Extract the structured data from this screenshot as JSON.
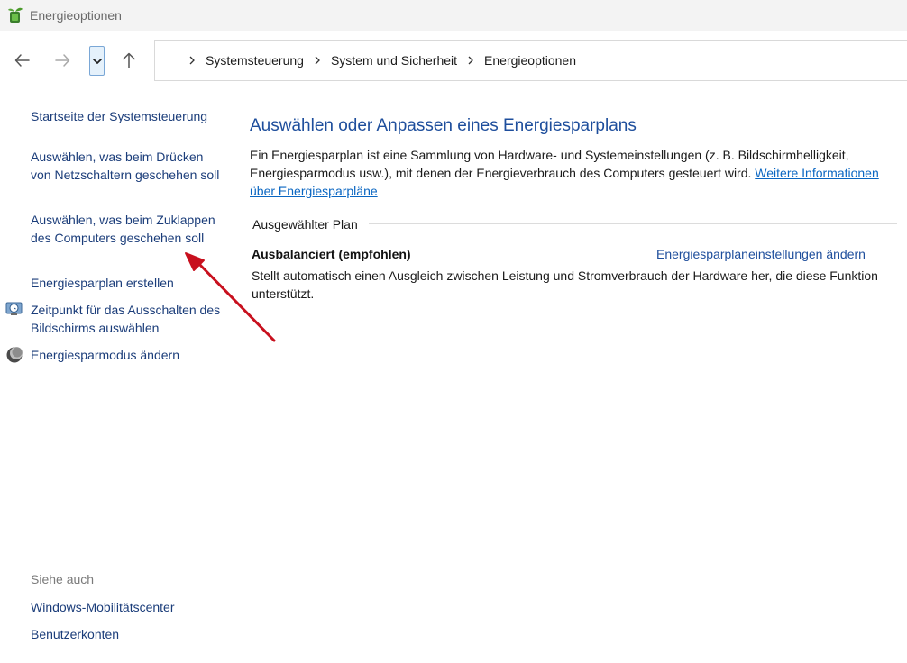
{
  "window": {
    "title": "Energieoptionen"
  },
  "address_bar": {
    "breadcrumbs": [
      "Systemsteuerung",
      "System und Sicherheit",
      "Energieoptionen"
    ]
  },
  "sidebar": {
    "home_link": "Startseite der Systemsteuerung",
    "tasks": [
      "Auswählen, was beim Drücken von Netzschaltern geschehen soll",
      "Auswählen, was beim Zuklappen des Computers geschehen soll",
      "Energiesparplan erstellen",
      "Zeitpunkt für das Ausschalten des Bildschirms auswählen",
      "Energiesparmodus ändern"
    ],
    "see_also_heading": "Siehe auch",
    "see_also": [
      "Windows-Mobilitätscenter",
      "Benutzerkonten"
    ]
  },
  "main": {
    "heading": "Auswählen oder Anpassen eines Energiesparplans",
    "description": "Ein Energiesparplan ist eine Sammlung von Hardware- und Systemeinstellungen (z. B. Bildschirmhelligkeit, Energiesparmodus usw.), mit denen der Energieverbrauch des Computers gesteuert wird.",
    "more_info_link": "Weitere Informationen über Energiesparpläne",
    "selected_plan_heading": "Ausgewählter Plan",
    "plan": {
      "name": "Ausbalanciert (empfohlen)",
      "change_link": "Energiesparplaneinstellungen ändern",
      "description": "Stellt automatisch einen Ausgleich zwischen Leistung und Stromverbrauch der Hardware her, die diese Funktion unterstützt."
    }
  },
  "colors": {
    "link": "#1b3d7a",
    "heading": "#1e4e9c",
    "hyperlink": "#0a66c2",
    "annotation_arrow": "#c8101e"
  },
  "icons": {
    "app": "battery-plant-icon",
    "back": "arrow-left-icon",
    "forward": "arrow-right-icon",
    "recent": "chevron-down-icon",
    "up": "arrow-up-icon",
    "screen_timer": "clock-monitor-icon",
    "sleep": "moon-icon"
  }
}
